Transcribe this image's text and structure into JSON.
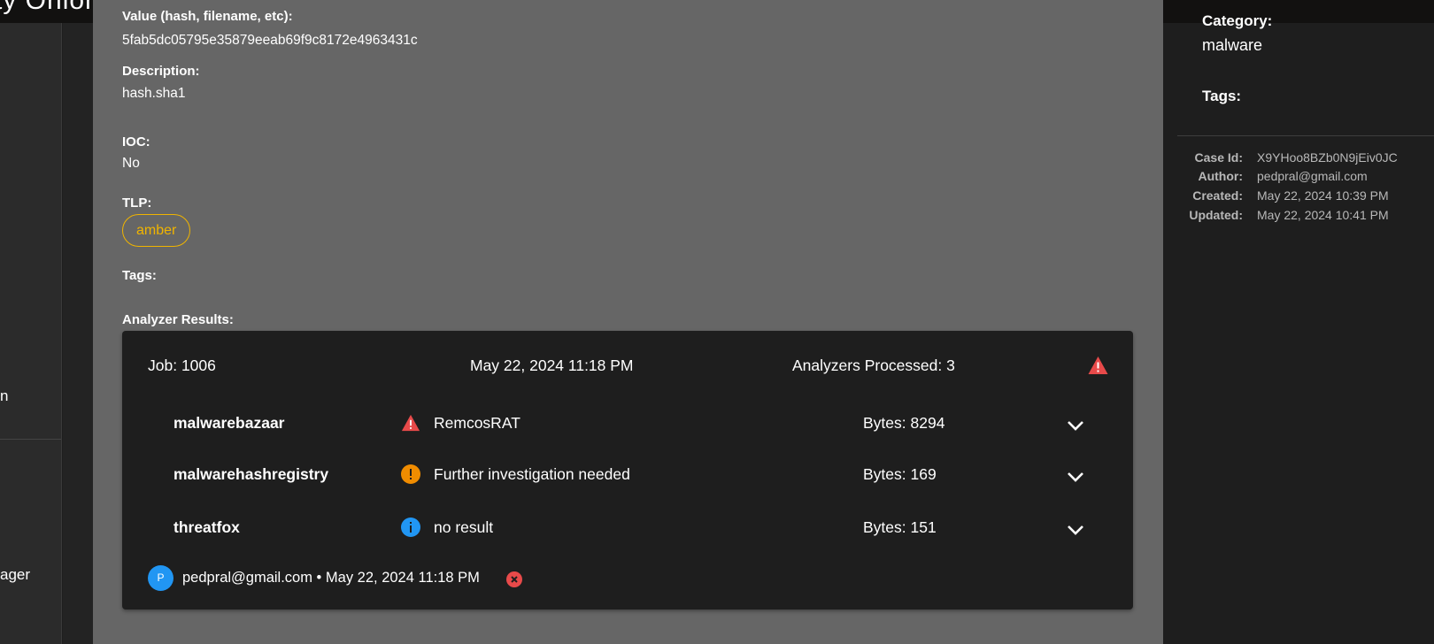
{
  "topbar": {
    "brand": "ty Onion"
  },
  "nav": {
    "item_a": "n",
    "item_b": "ager"
  },
  "observable": {
    "value_label": "Value (hash, filename, etc):",
    "value": "5fab5dc05795e35879eeab69f9c8172e4963431c",
    "description_label": "Description:",
    "description": "hash.sha1",
    "ioc_label": "IOC:",
    "ioc": "No",
    "tlp_label": "TLP:",
    "tlp": "amber",
    "tags_label": "Tags:",
    "analyzer_results_label": "Analyzer Results:"
  },
  "job": {
    "job_label": "Job: 1006",
    "date": "May 22, 2024 11:18 PM",
    "processed": "Analyzers Processed: 3",
    "analyzers": [
      {
        "name": "malwarebazaar",
        "status_icon": "warning-icon",
        "summary": "RemcosRAT",
        "bytes": "Bytes: 8294"
      },
      {
        "name": "malwarehashregistry",
        "status_icon": "alert-circle-icon",
        "summary": "Further investigation needed",
        "bytes": "Bytes: 169"
      },
      {
        "name": "threatfox",
        "status_icon": "info-icon",
        "summary": "no result",
        "bytes": "Bytes: 151"
      }
    ],
    "avatar_initial": "P",
    "footer": "pedpral@gmail.com • May 22, 2024 11:18 PM"
  },
  "case": {
    "category_label": "Category:",
    "category": "malware",
    "tags_label": "Tags:",
    "meta": [
      {
        "key": "Case Id:",
        "value": "X9YHoo8BZb0N9jEiv0JC"
      },
      {
        "key": "Author:",
        "value": "pedpral@gmail.com"
      },
      {
        "key": "Created:",
        "value": "May 22, 2024 10:39 PM"
      },
      {
        "key": "Updated:",
        "value": "May 22, 2024 10:41 PM"
      }
    ]
  },
  "colors": {
    "tlp_amber": "#f0b400",
    "warning_red": "#e84a4a",
    "alert_orange": "#f08c00",
    "info_blue": "#2196f3",
    "avatar_blue": "#2196f3"
  }
}
